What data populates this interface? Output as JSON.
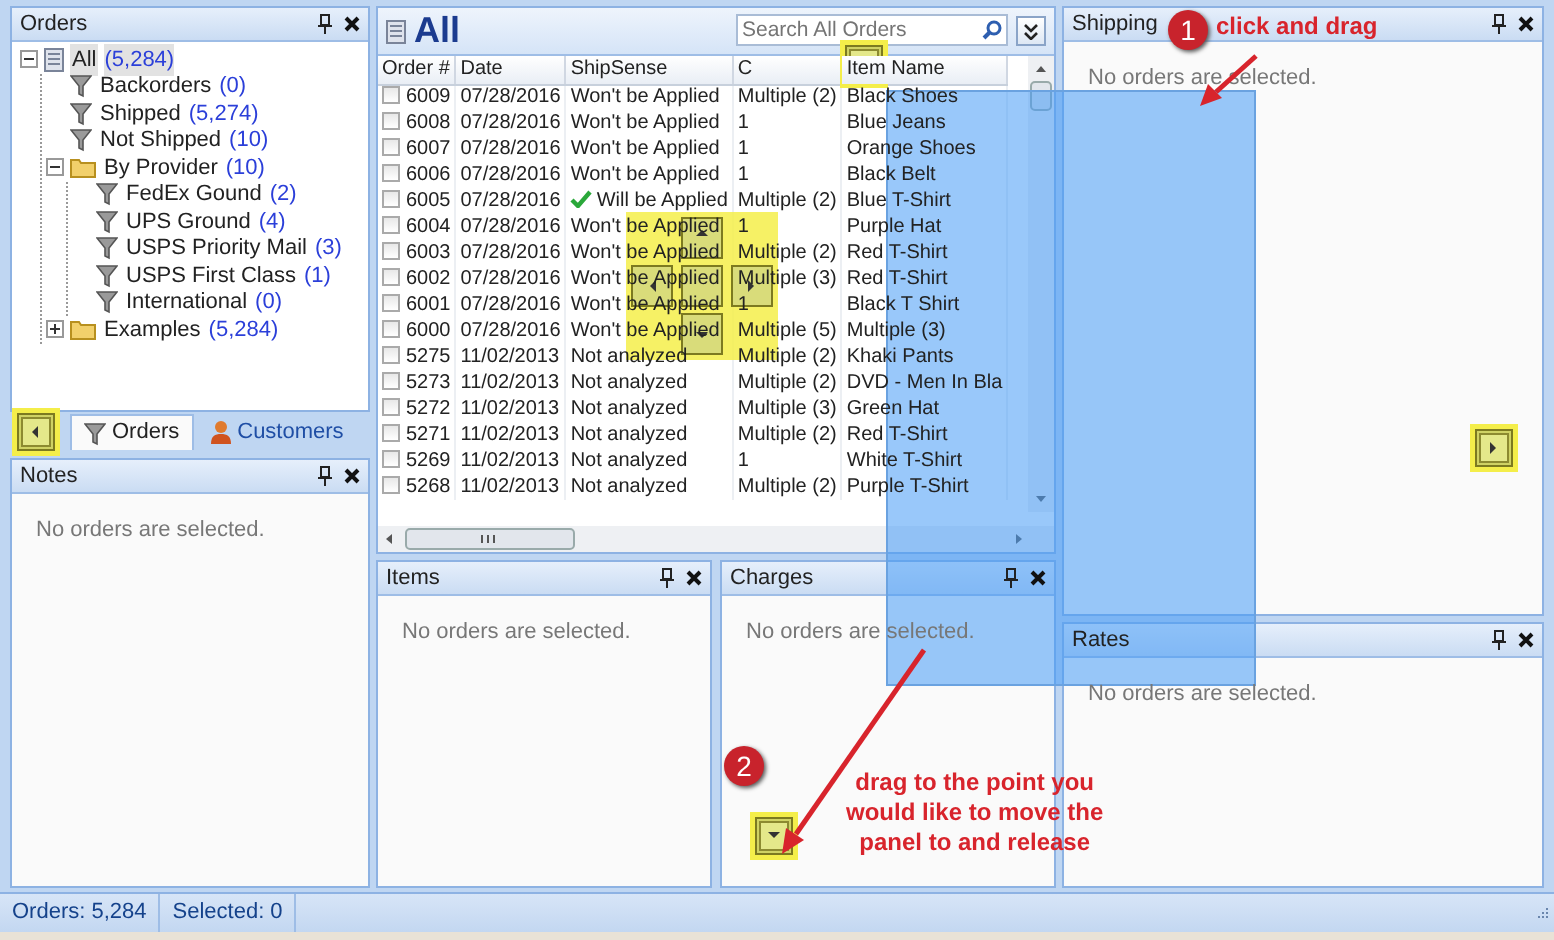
{
  "orders_panel": {
    "title": "Orders",
    "tree": [
      {
        "label": "All",
        "count": "(5,284)",
        "kind": "root",
        "selected": true,
        "expanded": true,
        "children": [
          {
            "label": "Backorders",
            "count": "(0)",
            "kind": "filter",
            "selected": false
          },
          {
            "label": "Shipped",
            "count": "(5,274)",
            "kind": "filter",
            "selected": false
          },
          {
            "label": "Not Shipped",
            "count": "(10)",
            "kind": "filter",
            "selected": false
          },
          {
            "label": "By Provider",
            "count": "(10)",
            "kind": "folder",
            "selected": false,
            "expanded": true,
            "children": [
              {
                "label": "FedEx Gound",
                "count": "(2)",
                "kind": "filter",
                "selected": false
              },
              {
                "label": "UPS Ground",
                "count": "(4)",
                "kind": "filter",
                "selected": false
              },
              {
                "label": "USPS Priority Mail",
                "count": "(3)",
                "kind": "filter",
                "selected": false
              },
              {
                "label": "USPS First Class",
                "count": "(1)",
                "kind": "filter",
                "selected": false
              },
              {
                "label": "International",
                "count": "(0)",
                "kind": "filter",
                "selected": false
              }
            ]
          },
          {
            "label": "Examples",
            "count": "(5,284)",
            "kind": "folder",
            "selected": false,
            "expanded": false
          }
        ]
      }
    ]
  },
  "left_tabs": [
    {
      "label": "Orders",
      "kind": "filter",
      "selected": true
    },
    {
      "label": "Customers",
      "kind": "person",
      "selected": false
    }
  ],
  "notes_panel": {
    "title": "Notes",
    "message": "No orders are selected."
  },
  "grid": {
    "title": "All",
    "search": {
      "placeholder": "Search All Orders"
    },
    "columns": [
      "Order #",
      "Date",
      "ShipSense",
      "C",
      "Item Name"
    ],
    "rows": [
      {
        "checked": false,
        "order": "6009",
        "date": "07/28/2016",
        "shipsense": "Won't be Applied",
        "applied": false,
        "column_4": "Multiple (2)",
        "item_name": "Black Shoes"
      },
      {
        "checked": false,
        "order": "6008",
        "date": "07/28/2016",
        "shipsense": "Won't be Applied",
        "applied": false,
        "column_4": "1",
        "item_name": "Blue Jeans"
      },
      {
        "checked": false,
        "order": "6007",
        "date": "07/28/2016",
        "shipsense": "Won't be Applied",
        "applied": false,
        "column_4": "1",
        "item_name": "Orange Shoes"
      },
      {
        "checked": false,
        "order": "6006",
        "date": "07/28/2016",
        "shipsense": "Won't be Applied",
        "applied": false,
        "column_4": "1",
        "item_name": "Black Belt"
      },
      {
        "checked": false,
        "order": "6005",
        "date": "07/28/2016",
        "shipsense": "Will be Applied",
        "applied": true,
        "column_4": "Multiple (2)",
        "item_name": "Blue T-Shirt"
      },
      {
        "checked": false,
        "order": "6004",
        "date": "07/28/2016",
        "shipsense": "Won't be Applied",
        "applied": false,
        "column_4": "1",
        "item_name": "Purple Hat"
      },
      {
        "checked": false,
        "order": "6003",
        "date": "07/28/2016",
        "shipsense": "Won't be Applied",
        "applied": false,
        "column_4": "Multiple (2)",
        "item_name": "Red T-Shirt"
      },
      {
        "checked": false,
        "order": "6002",
        "date": "07/28/2016",
        "shipsense": "Won't be Applied",
        "applied": false,
        "column_4": "Multiple (3)",
        "item_name": "Red T-Shirt"
      },
      {
        "checked": false,
        "order": "6001",
        "date": "07/28/2016",
        "shipsense": "Won't be Applied",
        "applied": false,
        "column_4": "1",
        "item_name": "Black T Shirt"
      },
      {
        "checked": false,
        "order": "6000",
        "date": "07/28/2016",
        "shipsense": "Won't be Applied",
        "applied": false,
        "column_4": "Multiple (5)",
        "item_name": "Multiple (3)"
      },
      {
        "checked": false,
        "order": "5275",
        "date": "11/02/2013",
        "shipsense": "Not analyzed",
        "applied": false,
        "column_4": "Multiple (2)",
        "item_name": "Khaki Pants"
      },
      {
        "checked": false,
        "order": "5273",
        "date": "11/02/2013",
        "shipsense": "Not analyzed",
        "applied": false,
        "column_4": "Multiple (2)",
        "item_name": "DVD - Men In Bla"
      },
      {
        "checked": false,
        "order": "5272",
        "date": "11/02/2013",
        "shipsense": "Not analyzed",
        "applied": false,
        "column_4": "Multiple (3)",
        "item_name": "Green Hat"
      },
      {
        "checked": false,
        "order": "5271",
        "date": "11/02/2013",
        "shipsense": "Not analyzed",
        "applied": false,
        "column_4": "Multiple (2)",
        "item_name": "Red T-Shirt"
      },
      {
        "checked": false,
        "order": "5269",
        "date": "11/02/2013",
        "shipsense": "Not analyzed",
        "applied": false,
        "column_4": "1",
        "item_name": "White T-Shirt"
      },
      {
        "checked": false,
        "order": "5268",
        "date": "11/02/2013",
        "shipsense": "Not analyzed",
        "applied": false,
        "column_4": "Multiple (2)",
        "item_name": "Purple T-Shirt"
      }
    ]
  },
  "items_panel": {
    "title": "Items",
    "message": "No orders are selected."
  },
  "charges_panel": {
    "title": "Charges",
    "message": "No orders are selected."
  },
  "shipping_panel": {
    "title": "Shipping",
    "message": "No orders are selected."
  },
  "rates_panel": {
    "title": "Rates",
    "message": "No orders are selected."
  },
  "status_bar": [
    "Orders: 5,284",
    "Selected: 0"
  ],
  "annotations": [
    {
      "number": "1",
      "lines": [
        "click and drag"
      ]
    },
    {
      "number": "2",
      "lines": [
        "drag to the point you",
        "would like to move the",
        "panel to and release"
      ]
    }
  ]
}
